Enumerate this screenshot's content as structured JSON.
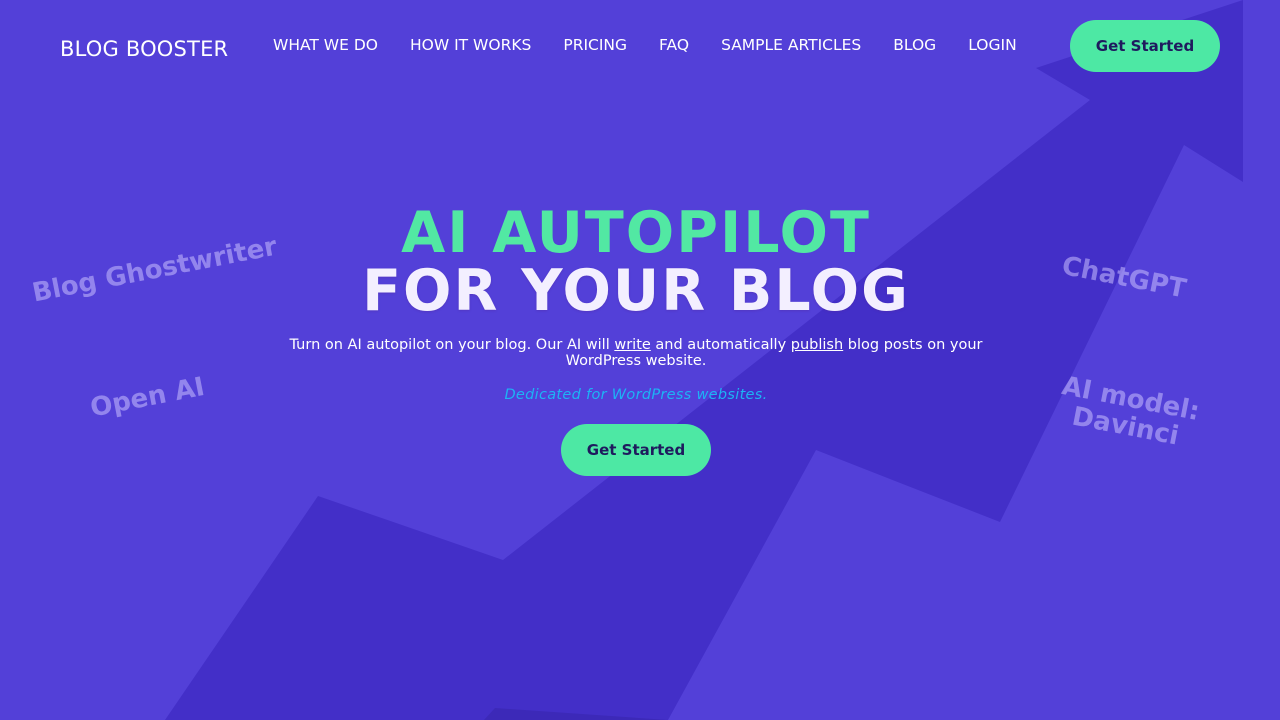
{
  "brand": {
    "logo_text": "BLOG BOOSTER"
  },
  "nav": {
    "items": [
      {
        "label": "WHAT WE DO"
      },
      {
        "label": "HOW IT WORKS"
      },
      {
        "label": "PRICING"
      },
      {
        "label": "FAQ"
      },
      {
        "label": "SAMPLE ARTICLES"
      },
      {
        "label": "BLOG"
      },
      {
        "label": "LOGIN"
      }
    ],
    "cta_label": "Get Started"
  },
  "hero": {
    "title_line1": "AI AUTOPILOT",
    "title_line2": "FOR YOUR BLOG",
    "desc_part1": "Turn on AI autopilot on your blog. Our AI will ",
    "desc_link1": "write",
    "desc_part2": " and automatically ",
    "desc_link2": "publish",
    "desc_part3": " blog posts on your WordPress website.",
    "note": "Dedicated for WordPress websites.",
    "cta_label": "Get Started"
  },
  "floating_tags": {
    "ghostwriter": "Blog Ghostwriter",
    "openai": "Open AI",
    "chatgpt": "ChatGPT",
    "davinci_line1": "AI model:",
    "davinci_line2": "Davinci"
  },
  "colors": {
    "background": "#5340d8",
    "arrow": "#432fc8",
    "accent_green": "#4de8a4",
    "note_blue": "#1db3f5"
  }
}
